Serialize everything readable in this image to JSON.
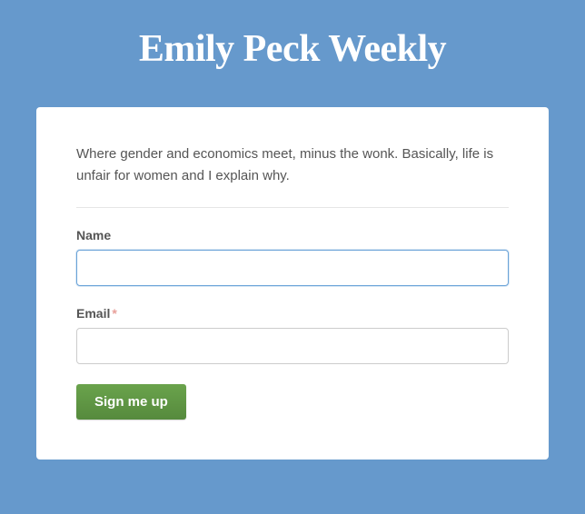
{
  "header": {
    "title": "Emily Peck Weekly"
  },
  "form": {
    "description": "Where gender and economics meet, minus the wonk. Basically, life is unfair for women and I explain why.",
    "name_label": "Name",
    "email_label": "Email",
    "required_mark": "*",
    "submit_label": "Sign me up"
  }
}
